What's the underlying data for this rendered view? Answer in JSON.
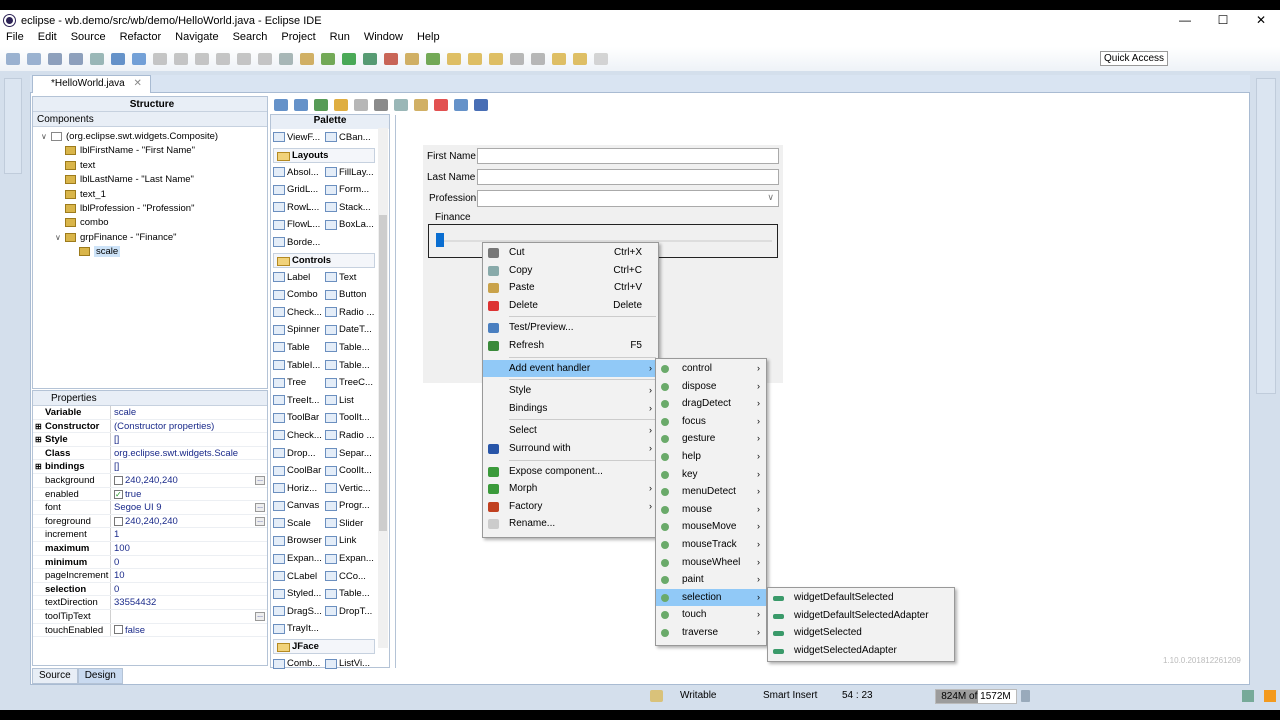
{
  "window": {
    "title": "eclipse - wb.demo/src/wb/demo/HelloWorld.java - Eclipse IDE",
    "controls": [
      "—",
      "☐",
      "✕"
    ]
  },
  "menu": [
    "File",
    "Edit",
    "Source",
    "Refactor",
    "Navigate",
    "Search",
    "Project",
    "Run",
    "Window",
    "Help"
  ],
  "toolbar": {
    "quick_access": "Quick Access"
  },
  "editor": {
    "tab": "*HelloWorld.java",
    "tab_close": "✕",
    "version": "1.10.0.201812261209"
  },
  "structure": {
    "title": "Structure",
    "components_label": "Components",
    "tree": [
      {
        "label": "(org.eclipse.swt.widgets.Composite)",
        "depth": 0,
        "exp": "∨"
      },
      {
        "label": "lblFirstName - \"First Name\"",
        "depth": 1
      },
      {
        "label": "text",
        "depth": 1
      },
      {
        "label": "lblLastName - \"Last Name\"",
        "depth": 1
      },
      {
        "label": "text_1",
        "depth": 1
      },
      {
        "label": "lblProfession - \"Profession\"",
        "depth": 1
      },
      {
        "label": "combo",
        "depth": 1
      },
      {
        "label": "grpFinance - \"Finance\"",
        "depth": 1,
        "exp": "∨"
      },
      {
        "label": "scale",
        "depth": 2,
        "selected": true
      }
    ]
  },
  "properties": {
    "title": "Properties",
    "rows": [
      {
        "k": "Variable",
        "v": "scale",
        "bold": true
      },
      {
        "k": "Constructor",
        "v": "(Constructor properties)",
        "bold": true,
        "exp": true
      },
      {
        "k": "Style",
        "v": "[]",
        "bold": true,
        "exp": true
      },
      {
        "k": "Class",
        "v": "org.eclipse.swt.widgets.Scale",
        "bold": true
      },
      {
        "k": "bindings",
        "v": "[]",
        "bold": true,
        "exp": true
      },
      {
        "k": "background",
        "v": "240,240,240",
        "cb": "",
        "dots": true
      },
      {
        "k": "enabled",
        "v": "true",
        "cb": "✓"
      },
      {
        "k": "font",
        "v": "Segoe UI 9",
        "dots": true
      },
      {
        "k": "foreground",
        "v": "240,240,240",
        "cb": "",
        "dots": true
      },
      {
        "k": "increment",
        "v": "1"
      },
      {
        "k": "maximum",
        "v": "100",
        "bold": true
      },
      {
        "k": "minimum",
        "v": "0",
        "bold": true
      },
      {
        "k": "pageIncrement",
        "v": "10"
      },
      {
        "k": "selection",
        "v": "0",
        "bold": true
      },
      {
        "k": "textDirection",
        "v": "33554432"
      },
      {
        "k": "toolTipText",
        "v": "",
        "dots": true
      },
      {
        "k": "touchEnabled",
        "v": "false",
        "cb": ""
      }
    ]
  },
  "bottom_tabs": [
    "Source",
    "Design"
  ],
  "palette": {
    "title": "Palette",
    "groups": [
      {
        "name": "",
        "items": [
          "ViewF...",
          "CBan..."
        ]
      },
      {
        "name": "Layouts",
        "items": [
          "Absol...",
          "FillLay...",
          "GridL...",
          "Form...",
          "RowL...",
          "Stack...",
          "FlowL...",
          "BoxLa...",
          "Borde..."
        ]
      },
      {
        "name": "Controls",
        "items": [
          "Label",
          "Text",
          "Combo",
          "Button",
          "Check...",
          "Radio ...",
          "Spinner",
          "DateT...",
          "Table",
          "Table...",
          "TableI...",
          "Table...",
          "Tree",
          "TreeC...",
          "TreeIt...",
          "List",
          "ToolBar",
          "ToolIt...",
          "Check...",
          "Radio ...",
          "Drop...",
          "Separ...",
          "CoolBar",
          "CoolIt...",
          "Horiz...",
          "Vertic...",
          "Canvas",
          "Progr...",
          "Scale",
          "Slider",
          "Browser",
          "Link",
          "Expan...",
          "Expan...",
          "CLabel",
          "CCo...",
          "Styled...",
          "Table...",
          "DragS...",
          "DropT...",
          "TrayIt..."
        ]
      },
      {
        "name": "JFace",
        "items": [
          "Comb...",
          "ListVi..."
        ]
      }
    ]
  },
  "form": {
    "first_name": "First Name",
    "last_name": "Last Name",
    "profession": "Profession",
    "group": "Finance",
    "combo_arrow": "∨",
    "scale_selection": 0,
    "scale_max": 100
  },
  "context_menu": [
    {
      "label": "Cut",
      "sc": "Ctrl+X",
      "c": "#777"
    },
    {
      "label": "Copy",
      "sc": "Ctrl+C",
      "c": "#8aa"
    },
    {
      "label": "Paste",
      "sc": "Ctrl+V",
      "c": "#c9a24a"
    },
    {
      "label": "Delete",
      "sc": "Delete",
      "c": "#d33"
    },
    {
      "sep": true
    },
    {
      "label": "Test/Preview...",
      "c": "#4a7fc0"
    },
    {
      "label": "Refresh",
      "sc": "F5",
      "c": "#3a8a3a"
    },
    {
      "sep": true
    },
    {
      "label": "Add event handler",
      "sub": true,
      "hl": true
    },
    {
      "sep": true
    },
    {
      "label": "Style",
      "sub": true
    },
    {
      "label": "Bindings",
      "sub": true
    },
    {
      "sep": true
    },
    {
      "label": "Select",
      "sub": true
    },
    {
      "label": "Surround with",
      "sub": true,
      "c": "#2855a8"
    },
    {
      "sep": true
    },
    {
      "label": "Expose component...",
      "c": "#3a9a3a"
    },
    {
      "label": "Morph",
      "sub": true,
      "c": "#3a9a3a"
    },
    {
      "label": "Factory",
      "sub": true,
      "c": "#c04020"
    },
    {
      "label": "Rename...",
      "c": "#ccc"
    }
  ],
  "event_menu": [
    "control",
    "dispose",
    "dragDetect",
    "focus",
    "gesture",
    "help",
    "key",
    "menuDetect",
    "mouse",
    "mouseMove",
    "mouseTrack",
    "mouseWheel",
    "paint",
    "selection",
    "touch",
    "traverse"
  ],
  "event_menu_highlight": "selection",
  "selection_menu": [
    "widgetDefaultSelected",
    "widgetDefaultSelectedAdapter",
    "widgetSelected",
    "widgetSelectedAdapter"
  ],
  "status": {
    "writable": "Writable",
    "insert_mode": "Smart Insert",
    "position": "54 : 23",
    "memory": "824M of 1572M",
    "memory_used_fraction": 0.524
  }
}
